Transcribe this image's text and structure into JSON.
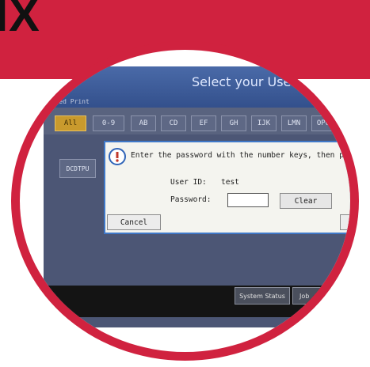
{
  "header": {
    "brand_fragment": "IX"
  },
  "screen": {
    "title": "Select your User ID",
    "section_label": "Locked Print",
    "tabs": [
      {
        "label": "All",
        "active": true
      },
      {
        "label": "0-9",
        "active": false
      },
      {
        "label": "AB",
        "active": false
      },
      {
        "label": "CD",
        "active": false
      },
      {
        "label": "EF",
        "active": false
      },
      {
        "label": "GH",
        "active": false
      },
      {
        "label": "IJK",
        "active": false
      },
      {
        "label": "LMN",
        "active": false
      },
      {
        "label": "OPQ",
        "active": false
      }
    ],
    "user_button": "DCDTPU",
    "footer": {
      "system_status": "System Status",
      "job_list": "Job"
    }
  },
  "dialog": {
    "message": "Enter the password with the number keys, then press [OK",
    "user_id_label": "User ID:",
    "user_id_value": "test",
    "password_label": "Password:",
    "password_value": "",
    "clear_label": "Clear",
    "cancel_label": "Cancel"
  },
  "colors": {
    "accent_red": "#d0223f",
    "dialog_border": "#3f78c8",
    "active_tab": "#c99a2d"
  }
}
